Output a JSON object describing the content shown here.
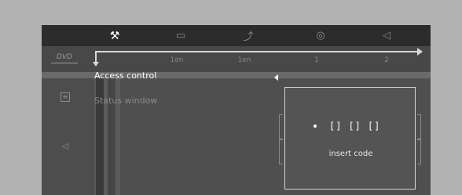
{
  "topbar": {
    "tabs": [
      {
        "icon": "settings-tools-icon",
        "glyph": "⚒",
        "active": true
      },
      {
        "icon": "subtitle-icon",
        "glyph": "▭",
        "active": false
      },
      {
        "icon": "camera-angle-icon",
        "glyph": "⤴",
        "active": false
      },
      {
        "icon": "audio-disc-icon",
        "glyph": "◎",
        "active": false
      },
      {
        "icon": "speaker-icon",
        "glyph": "◁",
        "active": false
      }
    ]
  },
  "status": {
    "disc_label": "DVD",
    "values": [
      "1en",
      "1en",
      "1",
      "2"
    ]
  },
  "menu": {
    "items": [
      {
        "label": "Access control",
        "selected": true
      },
      {
        "label": "Status window",
        "selected": false
      }
    ]
  },
  "dialog": {
    "slots": [
      "[]",
      "[]",
      "[]"
    ],
    "label": "insert code"
  },
  "colors": {
    "background": "#b3b3b3",
    "topbar": "#2c2c2c",
    "panel": "#4f4f4f",
    "highlight_text": "#ffffff",
    "dim_text": "#8a8a8a"
  }
}
